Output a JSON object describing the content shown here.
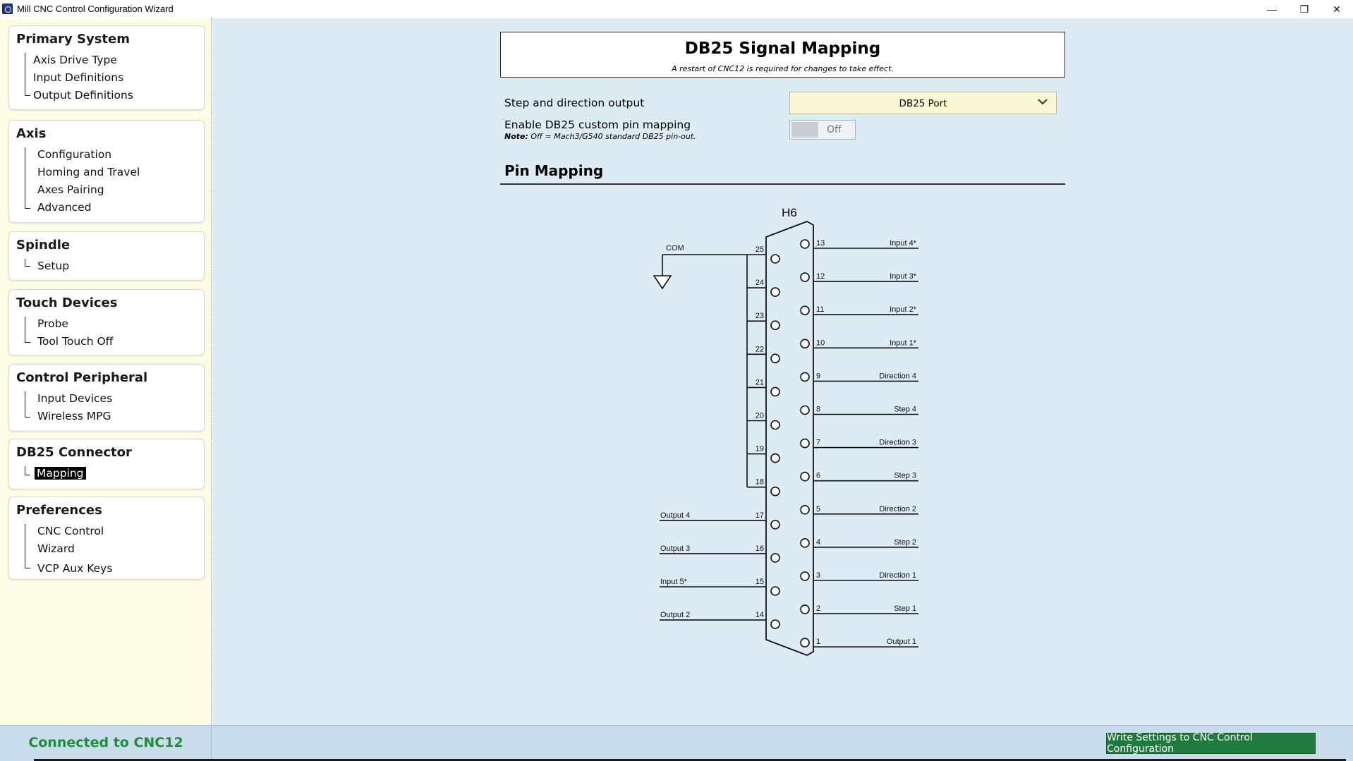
{
  "window": {
    "title": "Mill CNC Control Configuration Wizard",
    "minimize": "—",
    "maximize": "❐",
    "close": "✕"
  },
  "sidebar": {
    "groups": [
      {
        "title": "Primary System",
        "items": [
          "Axis Drive Type",
          "Input Definitions",
          "Output Definitions"
        ]
      },
      {
        "title": "Axis",
        "items": [
          "Configuration",
          "Homing and Travel",
          "Axes Pairing",
          "Advanced"
        ]
      },
      {
        "title": "Spindle",
        "items": [
          "Setup"
        ]
      },
      {
        "title": "Touch Devices",
        "items": [
          "Probe",
          "Tool Touch Off"
        ]
      },
      {
        "title": "Control Peripheral",
        "items": [
          "Input Devices",
          "Wireless MPG"
        ]
      },
      {
        "title": "DB25 Connector",
        "items": [
          "Mapping"
        ]
      },
      {
        "title": "Preferences",
        "items": [
          "CNC Control",
          "Wizard",
          "VCP Aux Keys"
        ]
      }
    ],
    "selected": "Mapping"
  },
  "main": {
    "title": "DB25 Signal Mapping",
    "subtitle": "A restart of CNC12 is required for changes to take effect.",
    "step_dir_label": "Step and direction output",
    "step_dir_value": "DB25 Port",
    "enable_label": "Enable DB25 custom pin mapping",
    "note_bold": "Note:",
    "note_text": "Off = Mach3/G540 standard DB25 pin-out.",
    "toggle_state": "Off",
    "pin_heading": "Pin Mapping"
  },
  "connector": {
    "name": "H6",
    "com_label": "COM",
    "right_pins": [
      {
        "pin": "13",
        "label": "Input 4*"
      },
      {
        "pin": "12",
        "label": "Input 3*"
      },
      {
        "pin": "11",
        "label": "Input 2*"
      },
      {
        "pin": "10",
        "label": "Input 1*"
      },
      {
        "pin": "9",
        "label": "Direction 4"
      },
      {
        "pin": "8",
        "label": "Step 4"
      },
      {
        "pin": "7",
        "label": "Direction 3"
      },
      {
        "pin": "6",
        "label": "Step 3"
      },
      {
        "pin": "5",
        "label": "Direction 2"
      },
      {
        "pin": "4",
        "label": "Step 2"
      },
      {
        "pin": "3",
        "label": "Direction 1"
      },
      {
        "pin": "2",
        "label": "Step 1"
      },
      {
        "pin": "1",
        "label": "Output 1"
      }
    ],
    "left_pins": [
      {
        "pin": "25",
        "label": ""
      },
      {
        "pin": "24",
        "label": ""
      },
      {
        "pin": "23",
        "label": ""
      },
      {
        "pin": "22",
        "label": ""
      },
      {
        "pin": "21",
        "label": ""
      },
      {
        "pin": "20",
        "label": ""
      },
      {
        "pin": "19",
        "label": ""
      },
      {
        "pin": "18",
        "label": ""
      },
      {
        "pin": "17",
        "label": "Output 4"
      },
      {
        "pin": "16",
        "label": "Output 3"
      },
      {
        "pin": "15",
        "label": "Input 5*"
      },
      {
        "pin": "14",
        "label": "Output 2"
      }
    ]
  },
  "footer": {
    "status": "Connected to CNC12",
    "write_button": "Write Settings to CNC Control Configuration"
  },
  "colors": {
    "sidebar_bg": "#fdfde6",
    "main_bg": "#dcebf4",
    "status_green": "#1e8c3a",
    "button_green": "#1f7a3d"
  }
}
